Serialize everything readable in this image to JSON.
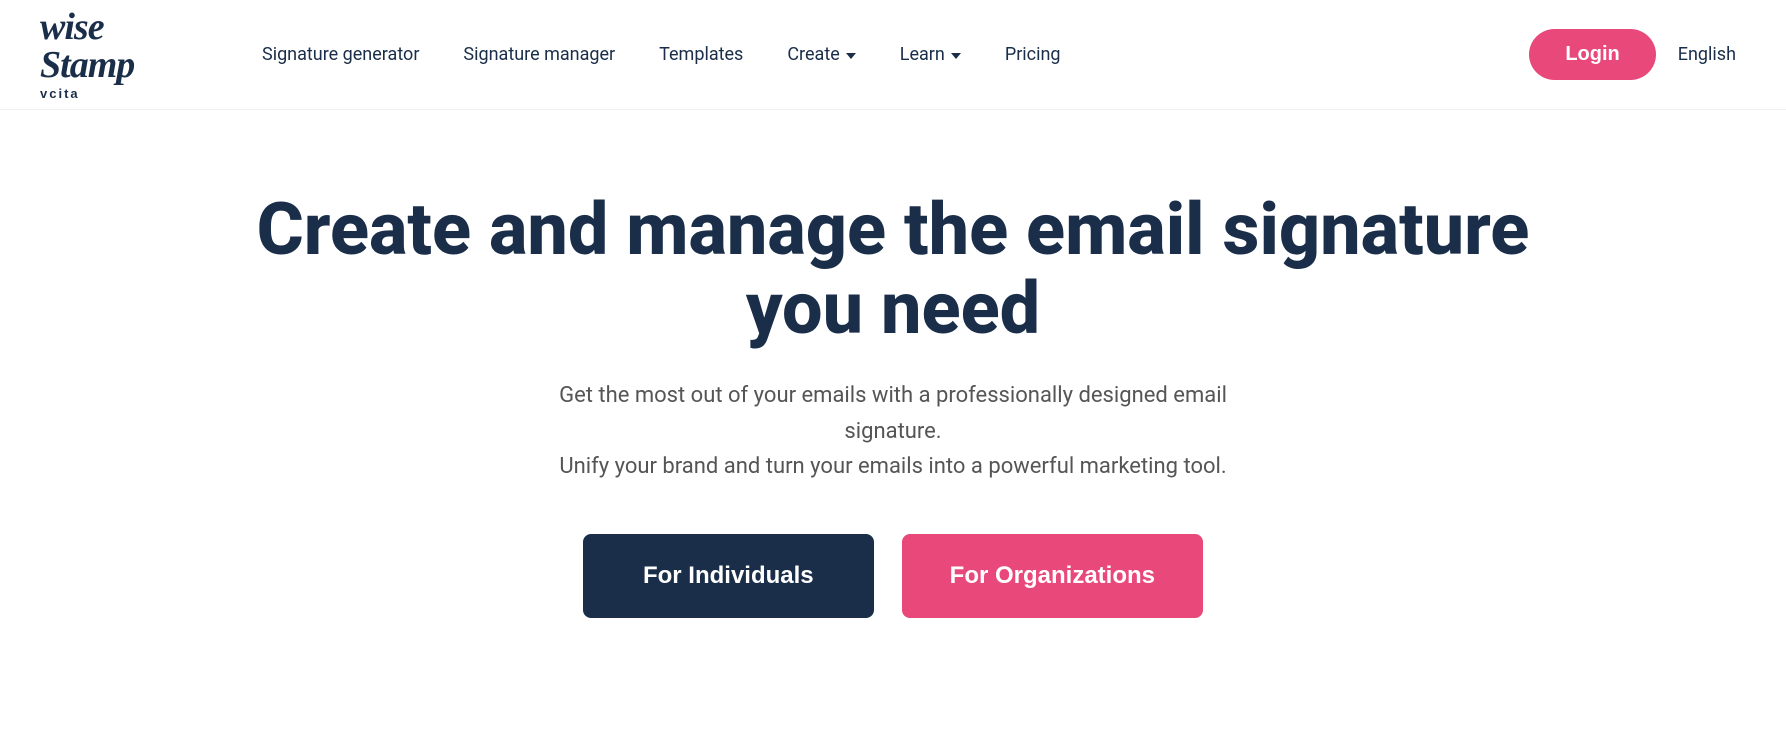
{
  "brand": {
    "name_line1": "wise",
    "name_line2": "Stamp",
    "sub": "vcita"
  },
  "nav": {
    "links": [
      {
        "label": "Signature generator",
        "dropdown": false
      },
      {
        "label": "Signature manager",
        "dropdown": false
      },
      {
        "label": "Templates",
        "dropdown": false
      },
      {
        "label": "Create",
        "dropdown": true
      },
      {
        "label": "Learn",
        "dropdown": true
      },
      {
        "label": "Pricing",
        "dropdown": false
      }
    ],
    "login_label": "Login",
    "language_label": "English"
  },
  "hero": {
    "title": "Create and manage the email signature you need",
    "subtitle_line1": "Get the most out of your emails with a professionally designed email signature.",
    "subtitle_line2": "Unify your brand and turn your emails into a powerful marketing tool.",
    "btn_individuals": "For Individuals",
    "btn_organizations": "For Organizations"
  },
  "colors": {
    "dark_navy": "#1a2e4a",
    "pink": "#e8487a"
  }
}
